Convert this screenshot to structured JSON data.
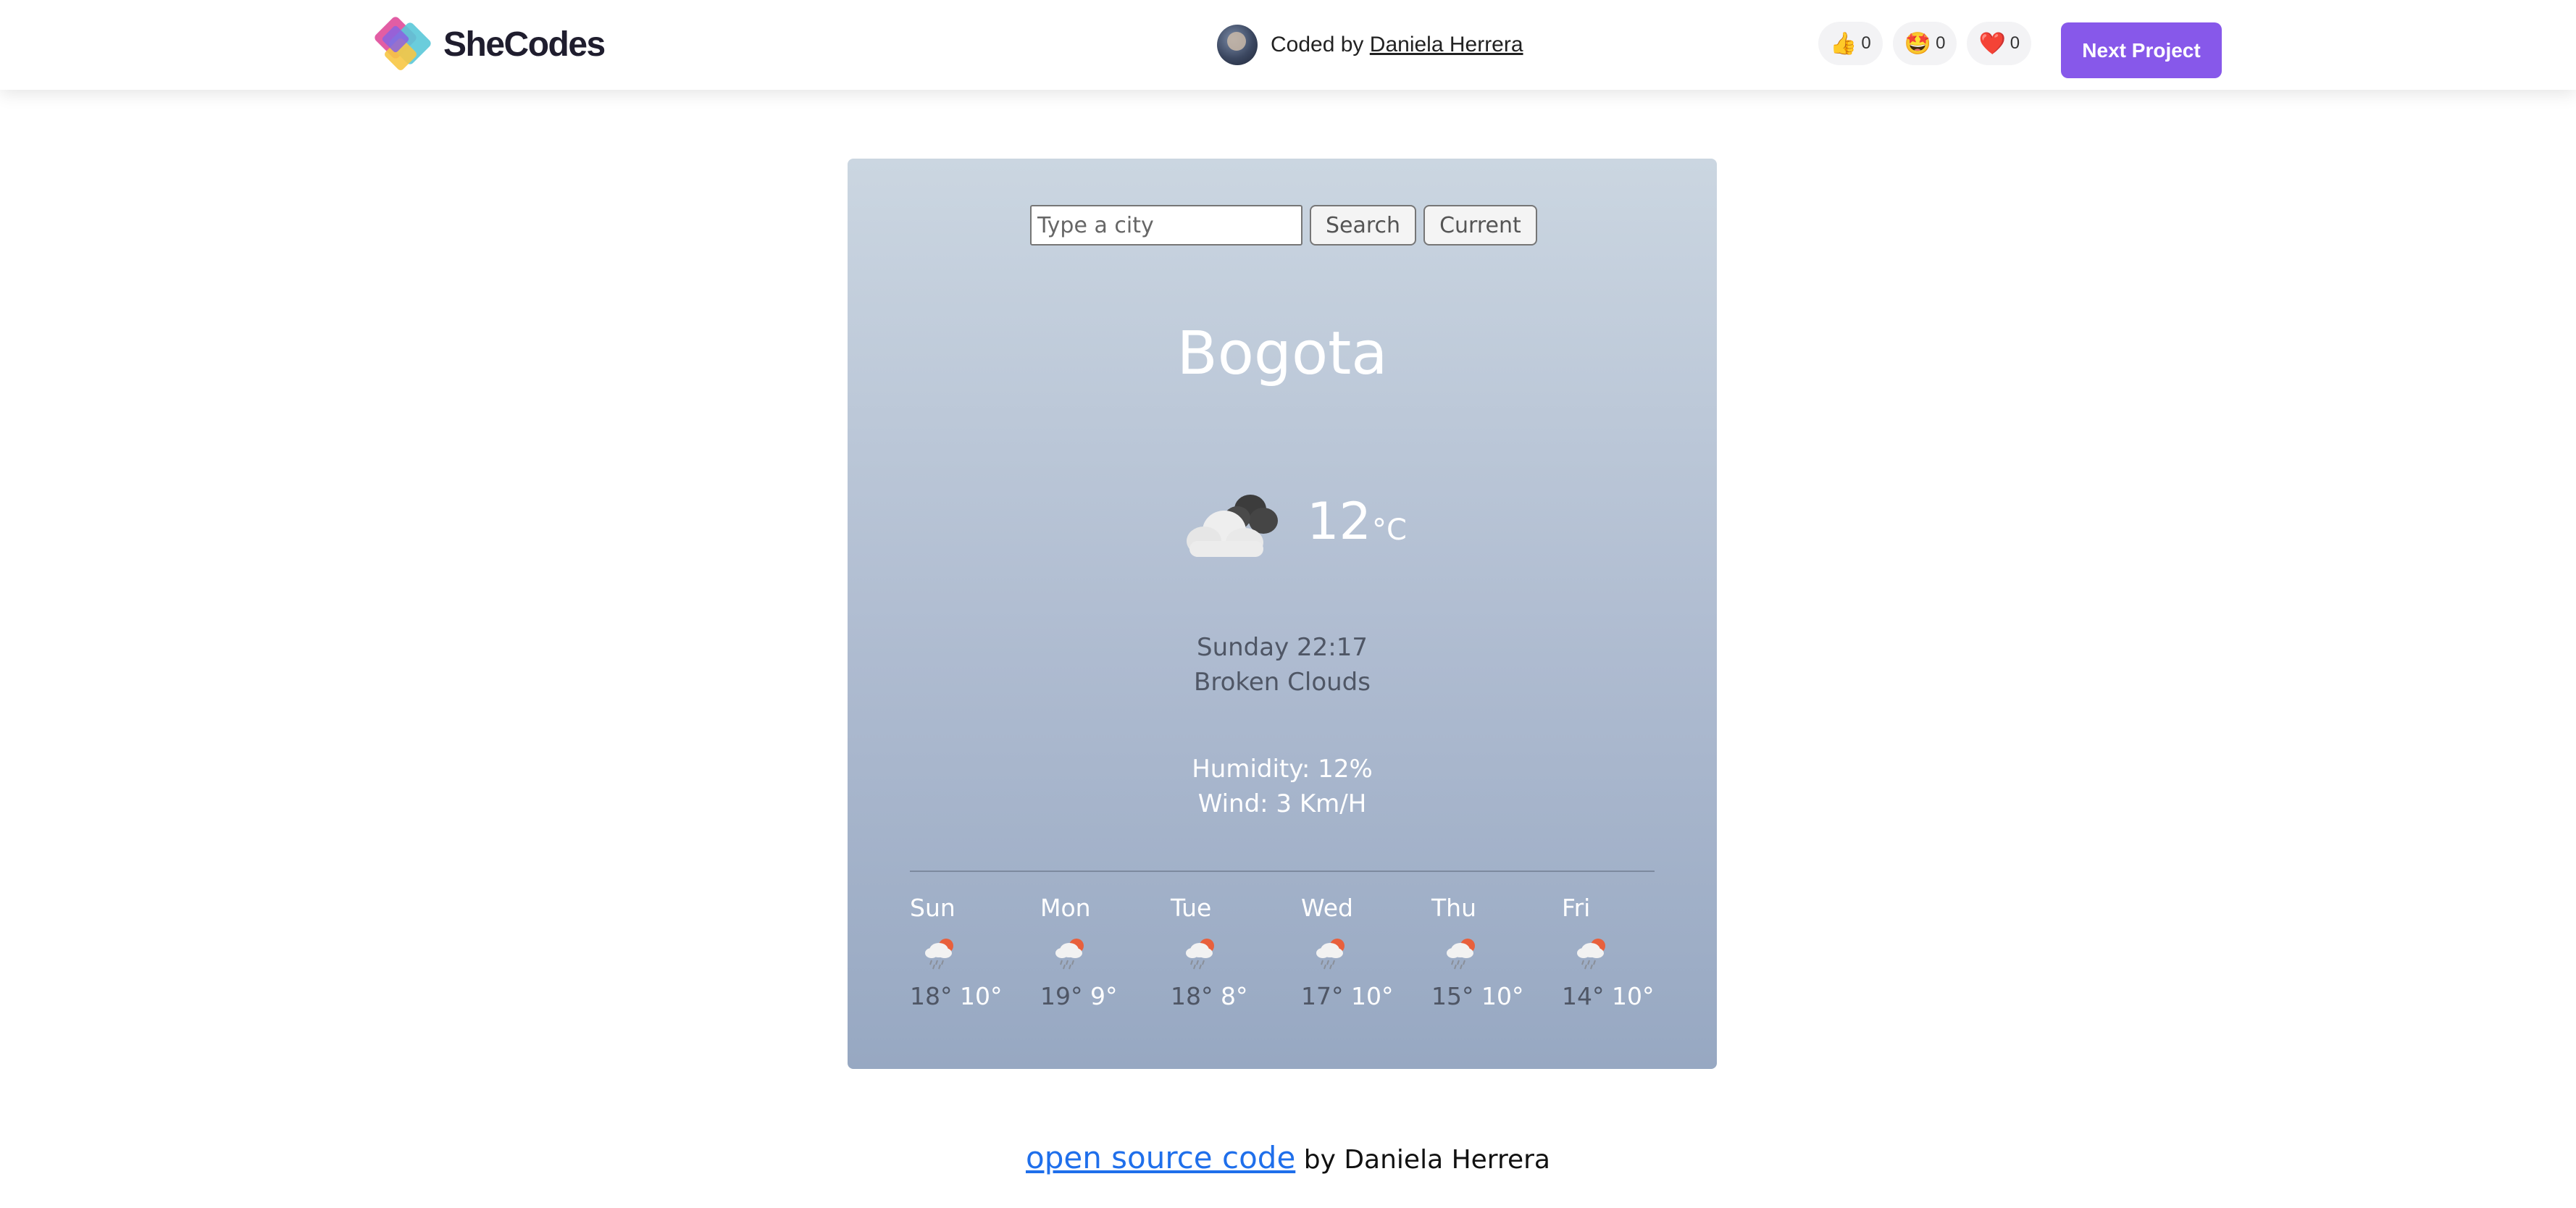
{
  "nav": {
    "brand": "SheCodes",
    "coded_prefix": "Coded by",
    "coded_author": "Daniela Herrera",
    "reactions": [
      {
        "icon": "thumbs-up-icon",
        "emoji": "👍",
        "count": "0"
      },
      {
        "icon": "star-struck-icon",
        "emoji": "🤩",
        "count": "0"
      },
      {
        "icon": "heart-icon",
        "emoji": "❤️",
        "count": "0"
      }
    ],
    "next_label": "Next Project",
    "accent": "#8758ea"
  },
  "search": {
    "placeholder": "Type a city",
    "search_label": "Search",
    "current_label": "Current"
  },
  "weather": {
    "city": "Bogota",
    "temperature": "12",
    "unit": "°C",
    "icon": "broken-clouds-icon",
    "datetime": "Sunday 22:17",
    "description": "Broken Clouds",
    "humidity": "Humidity: 12%",
    "wind": "Wind: 3 Km/H"
  },
  "forecast": [
    {
      "day": "Sun",
      "high": "18°",
      "low": "10°",
      "icon": "rain-sun-icon"
    },
    {
      "day": "Mon",
      "high": "19°",
      "low": "9°",
      "icon": "rain-sun-icon"
    },
    {
      "day": "Tue",
      "high": "18°",
      "low": "8°",
      "icon": "rain-sun-icon"
    },
    {
      "day": "Wed",
      "high": "17°",
      "low": "10°",
      "icon": "rain-sun-icon"
    },
    {
      "day": "Thu",
      "high": "15°",
      "low": "10°",
      "icon": "rain-sun-icon"
    },
    {
      "day": "Fri",
      "high": "14°",
      "low": "10°",
      "icon": "rain-sun-icon"
    }
  ],
  "footer": {
    "link_text": "open source code",
    "suffix": "by Daniela Herrera"
  }
}
